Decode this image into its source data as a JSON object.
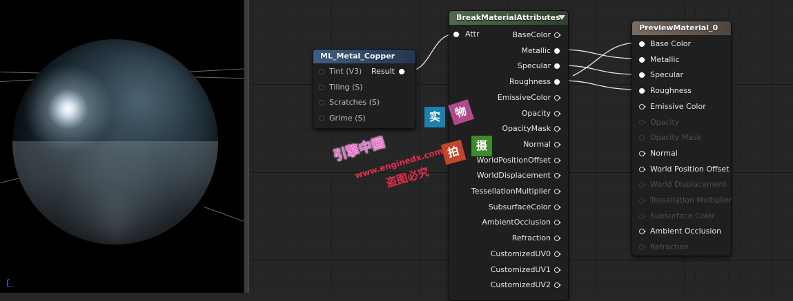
{
  "nodes": {
    "metal_copper": {
      "title": "ML_Metal_Copper",
      "header_color": "#3d5f84",
      "inputs": [
        {
          "label": "Tint (V3)"
        },
        {
          "label": "Tiling (S)"
        },
        {
          "label": "Scratches (S)"
        },
        {
          "label": "Grime (S)"
        }
      ],
      "output": "Result"
    },
    "break_attributes": {
      "title": "BreakMaterialAttributes",
      "header_color": "#4f6a4c",
      "input": "Attr",
      "outputs": [
        {
          "label": "BaseColor",
          "connected": false
        },
        {
          "label": "Metallic",
          "connected": true
        },
        {
          "label": "Specular",
          "connected": true
        },
        {
          "label": "Roughness",
          "connected": true
        },
        {
          "label": "EmissiveColor",
          "connected": false
        },
        {
          "label": "Opacity",
          "connected": false
        },
        {
          "label": "OpacityMask",
          "connected": false
        },
        {
          "label": "Normal",
          "connected": false
        },
        {
          "label": "WorldPositionOffset",
          "connected": false
        },
        {
          "label": "WorldDisplacement",
          "connected": false
        },
        {
          "label": "TessellationMultiplier",
          "connected": false
        },
        {
          "label": "SubsurfaceColor",
          "connected": false
        },
        {
          "label": "AmbientOcclusion",
          "connected": false
        },
        {
          "label": "Refraction",
          "connected": false
        },
        {
          "label": "CustomizedUV0",
          "connected": false
        },
        {
          "label": "CustomizedUV1",
          "connected": false
        },
        {
          "label": "CustomizedUV2",
          "connected": false
        }
      ]
    },
    "preview_material": {
      "title": "PreviewMaterial_0",
      "header_color": "#6e6259",
      "inputs": [
        {
          "label": "Base Color",
          "state": "connected"
        },
        {
          "label": "Metallic",
          "state": "connected"
        },
        {
          "label": "Specular",
          "state": "connected"
        },
        {
          "label": "Roughness",
          "state": "connected"
        },
        {
          "label": "Emissive Color",
          "state": "active"
        },
        {
          "label": "Opacity",
          "state": "disabled"
        },
        {
          "label": "Opacity Mask",
          "state": "disabled"
        },
        {
          "label": "Normal",
          "state": "active"
        },
        {
          "label": "World Position Offset",
          "state": "active"
        },
        {
          "label": "World Displacement",
          "state": "disabled"
        },
        {
          "label": "Tessellation Multiplier",
          "state": "disabled"
        },
        {
          "label": "Subsurface Color",
          "state": "disabled"
        },
        {
          "label": "Ambient Occlusion",
          "state": "active"
        },
        {
          "label": "Refraction",
          "state": "disabled"
        }
      ]
    }
  },
  "watermark": {
    "tiles": [
      {
        "text": "实",
        "color": "#1f7fb0"
      },
      {
        "text": "物",
        "color": "#b04a8c"
      },
      {
        "text": "拍",
        "color": "#c0452a"
      },
      {
        "text": "摄",
        "color": "#3f8a2a"
      }
    ],
    "line1": "引擎中国",
    "line2": "www.enginedx.com",
    "line3": "盗图必究"
  },
  "icons": {
    "viewport_axis": "axis-gizmo-icon",
    "collapse": "collapse-arrow-icon"
  }
}
